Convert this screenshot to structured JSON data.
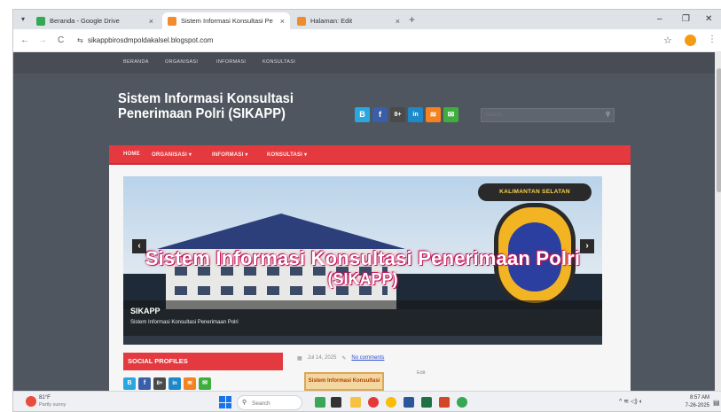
{
  "browser": {
    "tabs": [
      {
        "title": "Beranda - Google Drive",
        "favicon_color": "#34a853",
        "active": false
      },
      {
        "title": "Sistem Informasi Konsultasi Pe",
        "favicon_color": "#f08c2b",
        "active": true
      },
      {
        "title": "Halaman: Edit",
        "favicon_color": "#f08c2b",
        "active": false
      }
    ],
    "tab_close": "×",
    "new_tab": "+",
    "window_controls": {
      "minimize": "–",
      "restore": "❐",
      "close": "✕"
    },
    "nav": {
      "back": "←",
      "forward": "→",
      "reload": "C"
    },
    "url": "sikappbirosdmpoldakalsel.blogspot.com",
    "site_info_icon": "tune-icon",
    "bookmark_icon": "star-icon",
    "menu_icon": "⋮"
  },
  "blog": {
    "top_menu": [
      "BERANDA",
      "ORGANISASI",
      "INFORMASI",
      "KONSULTASI"
    ],
    "title_line1": "Sistem Informasi Konsultasi",
    "title_line2": "Penerimaan Polri (SIKAPP)",
    "social_top": [
      {
        "name": "blogger",
        "glyph": "B",
        "color": "#2aa7e0"
      },
      {
        "name": "facebook",
        "glyph": "f",
        "color": "#3b5ea8"
      },
      {
        "name": "googleplus",
        "glyph": "8+",
        "color": "#4a4a4a"
      },
      {
        "name": "linkedin",
        "glyph": "in",
        "color": "#1e88c8"
      },
      {
        "name": "rss",
        "glyph": "≋",
        "color": "#f58220"
      },
      {
        "name": "email",
        "glyph": "✉",
        "color": "#3fae3f"
      }
    ],
    "search_placeholder": "Search",
    "main_menu": [
      "HOME",
      "ORGANISASI ▾",
      "INFORMASI ▾",
      "KONSULTASI ▾"
    ],
    "slider": {
      "headline_line1": "Sistem Informasi Konsultasi Penerimaan Polri",
      "headline_line2": "(SIKAPP)",
      "badge_text": "KALIMANTAN SELATAN",
      "caption_title": "SIKAPP",
      "caption_sub": "Sistem Informasi Konsultasi Penerimaan Polri",
      "prev": "‹",
      "next": "›",
      "dots": "● ● ●"
    },
    "social_profiles_heading": "SOCIAL PROFILES",
    "social_profiles": [
      {
        "name": "blogger",
        "glyph": "B",
        "color": "#2aa7e0"
      },
      {
        "name": "facebook",
        "glyph": "f",
        "color": "#3b5ea8"
      },
      {
        "name": "googleplus",
        "glyph": "8+",
        "color": "#4a4a4a"
      },
      {
        "name": "linkedin",
        "glyph": "in",
        "color": "#1e88c8"
      },
      {
        "name": "rss",
        "glyph": "≋",
        "color": "#f58220"
      },
      {
        "name": "email",
        "glyph": "✉",
        "color": "#3fae3f"
      }
    ],
    "post": {
      "date": "Jul 14, 2025",
      "comments": "No comments",
      "thumb_text": "Sistem Informasi Konsultasi",
      "edit_label": "Edit"
    },
    "accent_color": "#e3393f"
  },
  "taskbar": {
    "weather_temp": "81°F",
    "weather_cond": "Partly sunny",
    "search_placeholder": "Search",
    "apps": [
      {
        "name": "widgets-app",
        "color": "#3aa757"
      },
      {
        "name": "task-view-app",
        "color": "#333333"
      },
      {
        "name": "file-explorer-app",
        "color": "#f5c242"
      },
      {
        "name": "opera-app",
        "color": "#e53935"
      },
      {
        "name": "chrome-app",
        "color": "#fbbc04"
      },
      {
        "name": "word-app",
        "color": "#2b579a"
      },
      {
        "name": "excel-app",
        "color": "#1e7145"
      },
      {
        "name": "powerpoint-app",
        "color": "#d24726"
      },
      {
        "name": "chrome-profile-app",
        "color": "#34a853"
      }
    ],
    "tray": "^  ≋  ◁)  ◐",
    "time": "8:57 AM",
    "date": "7-26-2025"
  }
}
